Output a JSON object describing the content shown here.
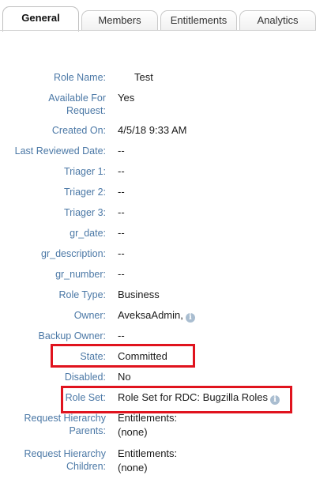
{
  "tabs": [
    {
      "label": "General",
      "active": true
    },
    {
      "label": "Members",
      "active": false
    },
    {
      "label": "Entitlements",
      "active": false
    },
    {
      "label": "Analytics",
      "active": false
    }
  ],
  "fields": [
    {
      "label": "Role Name:",
      "value": "Test"
    },
    {
      "label": "Available For Request:",
      "value": "Yes"
    },
    {
      "label": "Created On:",
      "value": "4/5/18 9:33 AM"
    },
    {
      "label": "Last Reviewed Date:",
      "value": "--"
    },
    {
      "label": "Triager 1:",
      "value": "--"
    },
    {
      "label": "Triager 2:",
      "value": "--"
    },
    {
      "label": "Triager 3:",
      "value": "--"
    },
    {
      "label": "gr_date:",
      "value": "--"
    },
    {
      "label": "gr_description:",
      "value": "--"
    },
    {
      "label": "gr_number:",
      "value": "--"
    },
    {
      "label": "Role Type:",
      "value": "Business"
    },
    {
      "label": "Owner:",
      "value": "AveksaAdmin,",
      "icon": "info-icon"
    },
    {
      "label": "Backup Owner:",
      "value": "--"
    },
    {
      "label": "State:",
      "value": "Committed",
      "highlighted": true
    },
    {
      "label": "Disabled:",
      "value": "No"
    },
    {
      "label": "Role Set:",
      "value": "Role Set for RDC: Bugzilla Roles",
      "icon": "info-icon",
      "highlighted": true
    },
    {
      "label": "Request Hierarchy Parents:",
      "value_line1": "Entitlements:",
      "value_line2": "(none)"
    },
    {
      "label": "Request Hierarchy Children:",
      "value_line1": "Entitlements:",
      "value_line2": "(none)"
    }
  ],
  "colors": {
    "label": "#4b78a6",
    "highlight": "#e0131e",
    "info_icon": "#a9bdd0"
  }
}
